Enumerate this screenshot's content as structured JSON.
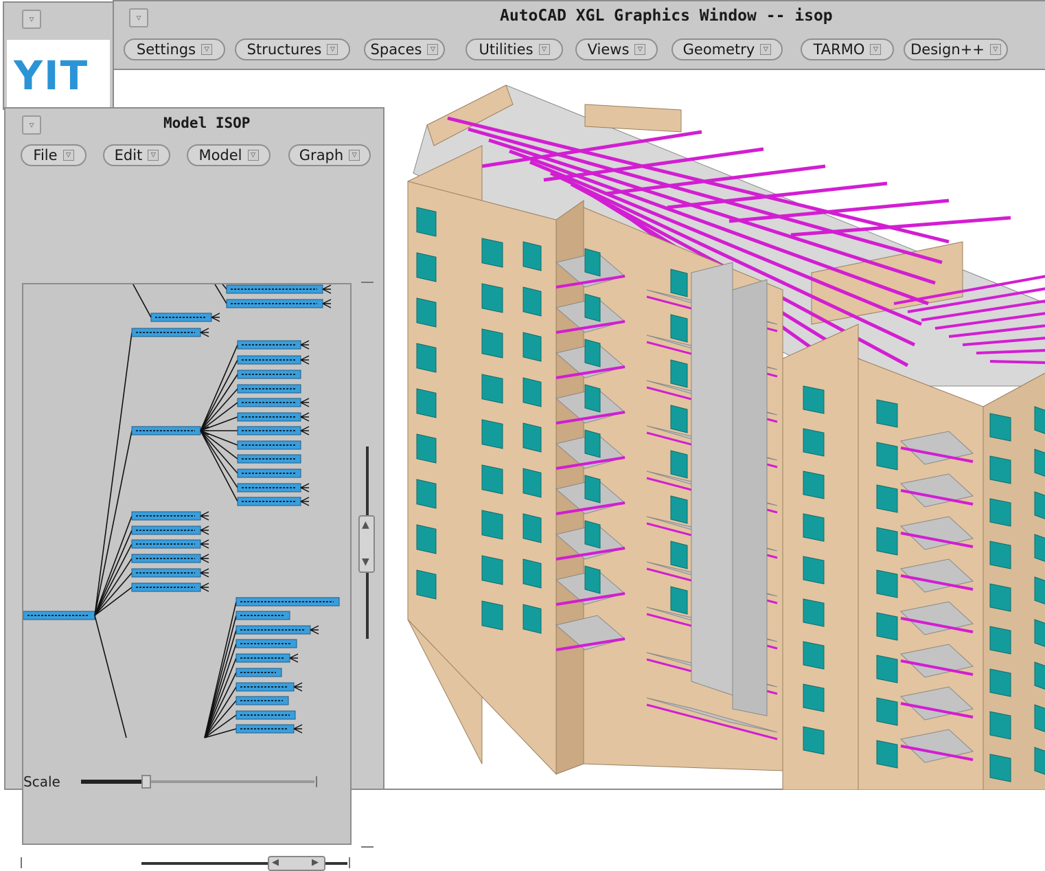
{
  "logo": {
    "text": "YIT",
    "color": "#2c94d6"
  },
  "main_window": {
    "title": "AutoCAD XGL Graphics Window -- isop",
    "menus": [
      "Settings",
      "Structures",
      "Spaces",
      "Utilities",
      "Views",
      "Geometry",
      "TARMO",
      "Design++"
    ]
  },
  "model_window": {
    "title": "Model ISOP",
    "menus": [
      "File",
      "Edit",
      "Model",
      "Graph"
    ],
    "scale_label": "Scale"
  },
  "colors": {
    "node_fill": "#3a9edc",
    "wall": "#e2c4a0",
    "window": "#149c9c",
    "pipe": "#d21ed2",
    "slab": "#c3c3c3",
    "panel_bg": "#c9c9c9"
  },
  "icons": {
    "window_menu": "triangle-down",
    "scroll_up": "triangle-up",
    "scroll_down": "triangle-down",
    "scroll_left": "triangle-left",
    "scroll_right": "triangle-right"
  }
}
